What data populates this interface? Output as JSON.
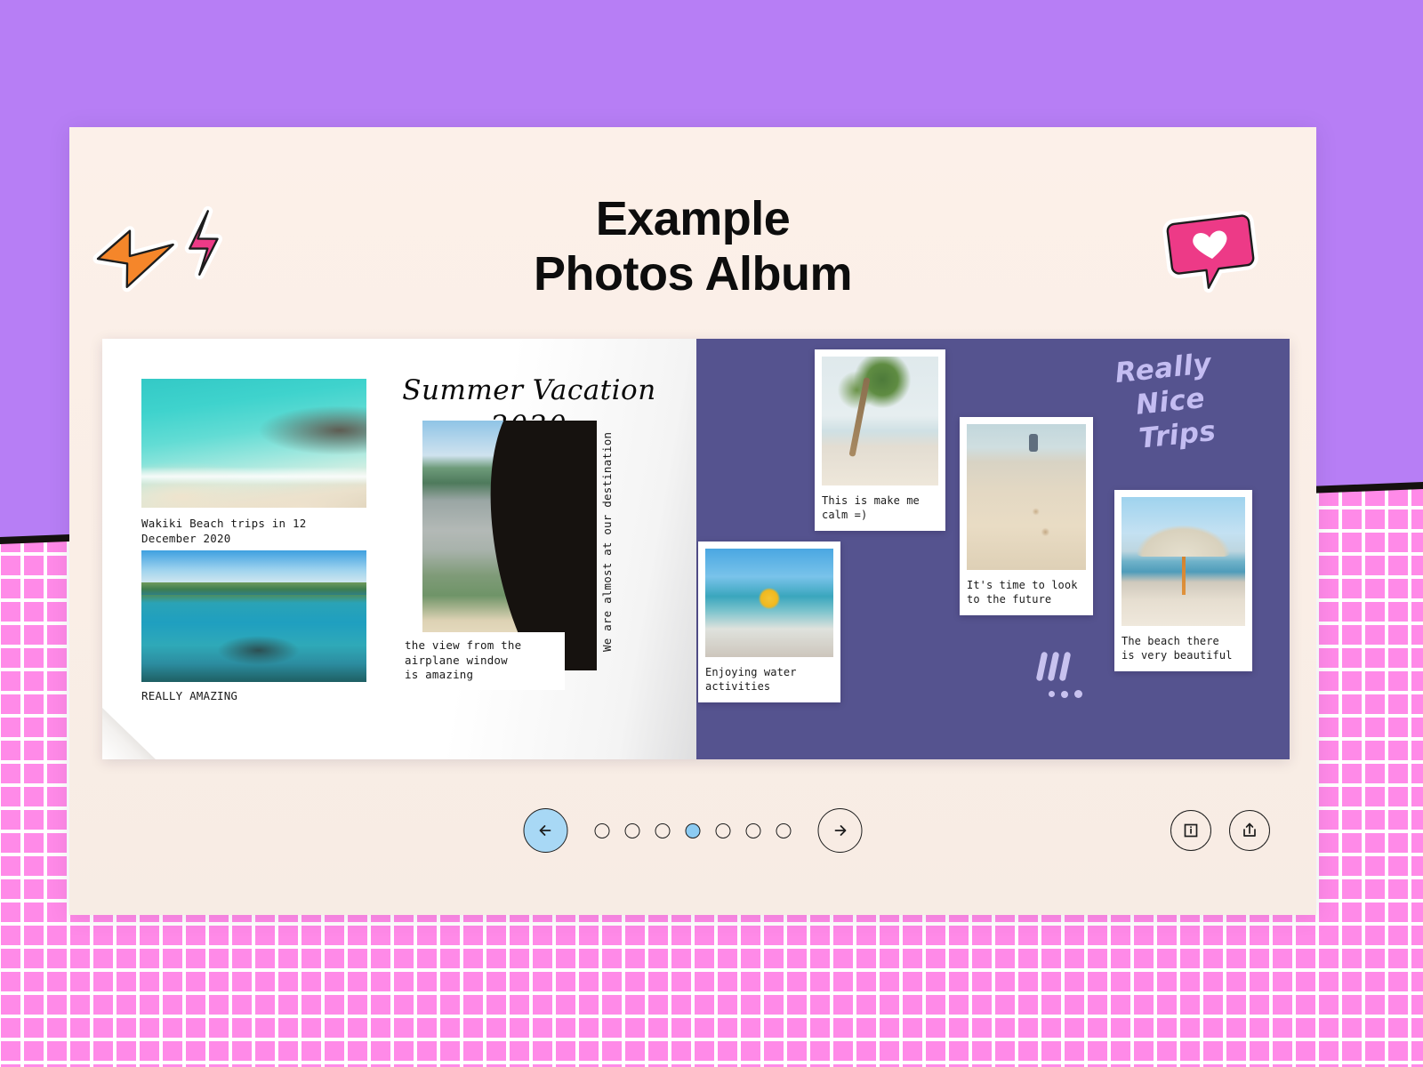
{
  "background": {
    "top_color": "#b77ef5",
    "grid_color": "#ff8ae8",
    "grid_line_color": "#ffffff",
    "divider_color": "#15110f"
  },
  "card": {
    "background_color": "#faeee6"
  },
  "header": {
    "title_line1": "Example",
    "title_line2": "Photos Album"
  },
  "stickers": [
    {
      "name": "lightning-bolt-orange",
      "color": "#f5862a"
    },
    {
      "name": "lightning-bolt-pink",
      "color": "#ed3a87"
    },
    {
      "name": "heart-speech-bubble",
      "color": "#ed3a87"
    }
  ],
  "album": {
    "left_page": {
      "background_color": "#ffffff",
      "heading_line1": "Summer Vacation",
      "heading_line2": "2020",
      "photos": [
        {
          "name": "waikiki-aerial-beach",
          "caption": "Wakiki Beach trips in 12\nDecember 2020"
        },
        {
          "name": "turtle-lagoon",
          "caption": "REALLY AMAZING"
        },
        {
          "name": "honolulu-from-airplane",
          "caption": "the view from the\nairplane window\nis amazing"
        }
      ],
      "vertical_caption": "We are almost at our destination"
    },
    "right_page": {
      "background_color": "#55538f",
      "handwritten": {
        "line1": "Really",
        "line2": "Nice",
        "line3": "Trips",
        "color": "#c4bdf2"
      },
      "polaroids": [
        {
          "name": "palm-tree-swing",
          "caption": "This is make me\ncalm =)"
        },
        {
          "name": "beach-footprints",
          "caption": "It's time to look\nto the future"
        },
        {
          "name": "child-water-floaties",
          "caption": "Enjoying water\nactivities"
        },
        {
          "name": "beach-umbrella",
          "caption": "The beach there\nis very beautiful"
        }
      ],
      "decorations": [
        "three-slanted-bars",
        "three-dots"
      ]
    }
  },
  "controls": {
    "prev_label": "←",
    "next_label": "→",
    "prev_active": true,
    "dot_count": 7,
    "active_dot_index": 3,
    "active_dot_color": "#8ccbf2",
    "info_icon": "info-icon",
    "share_icon": "share-icon"
  }
}
